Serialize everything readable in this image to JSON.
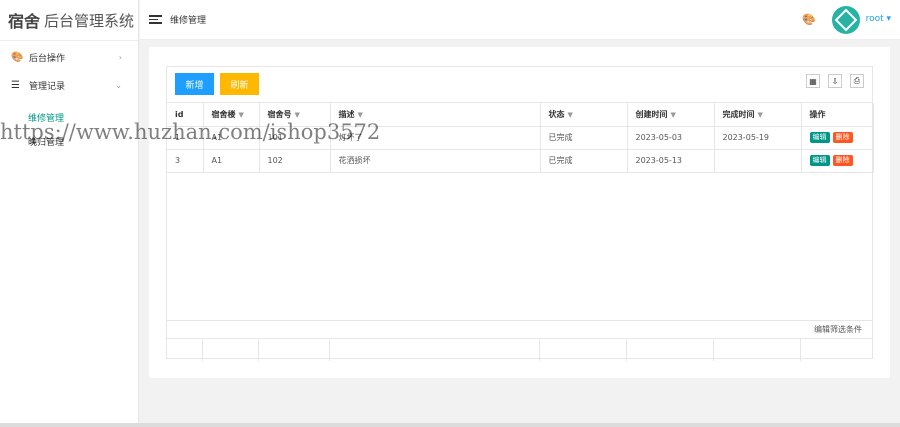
{
  "app": {
    "logo_part1": "宿舍",
    "logo_part2": "后台管理系统"
  },
  "sidebar": {
    "items": [
      {
        "label": "后台操作",
        "arrow": "›"
      },
      {
        "label": "管理记录",
        "arrow": "⌄"
      }
    ],
    "subitems": [
      {
        "label": "维修管理"
      },
      {
        "label": "晚归管理"
      }
    ]
  },
  "header": {
    "breadcrumb": "维修管理",
    "user": "root ▾"
  },
  "toolbar": {
    "add_label": "新增",
    "refresh_label": "刷新"
  },
  "table": {
    "columns": [
      "id",
      "宿舍楼",
      "宿舍号",
      "描述",
      "状态",
      "创建时间",
      "完成时间",
      "操作"
    ],
    "rows": [
      {
        "id": "1",
        "building": "A1",
        "room": "101",
        "desc": "灯坏了",
        "status": "已完成",
        "created": "2023-05-03",
        "finished": "2023-05-19"
      },
      {
        "id": "3",
        "building": "A1",
        "room": "102",
        "desc": "花洒损坏",
        "status": "已完成",
        "created": "2023-05-13",
        "finished": ""
      }
    ],
    "edit_label": "编辑",
    "delete_label": "删除",
    "footer_text": "编辑筛选条件"
  },
  "watermark": "https://www.huzhan.com/ishop3572",
  "colors": {
    "primary": "#1e9fff",
    "warm": "#ffb800",
    "teal": "#009688",
    "danger": "#ff5722"
  }
}
